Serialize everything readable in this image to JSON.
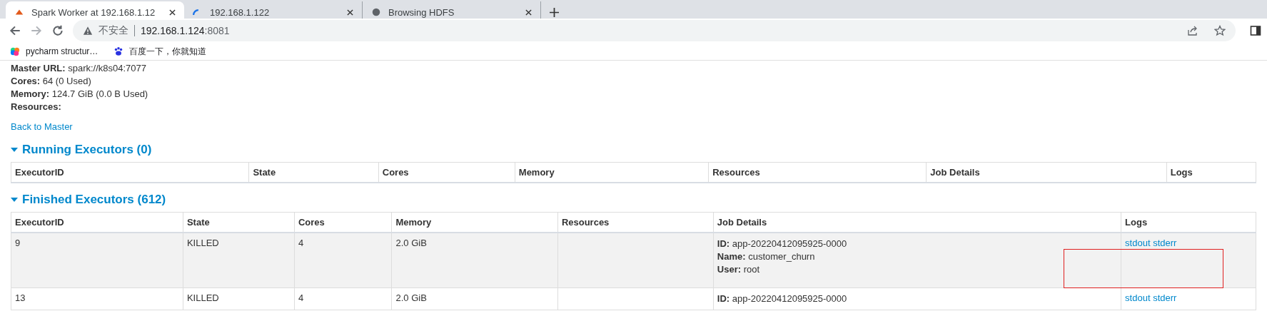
{
  "tabs": [
    {
      "title": "Spark Worker at 192.168.1.12",
      "kind": "spark",
      "selected": true
    },
    {
      "title": "192.168.1.122",
      "kind": "loading",
      "selected": false
    },
    {
      "title": "Browsing HDFS",
      "kind": "globe",
      "selected": false
    }
  ],
  "address": {
    "security": "不安全",
    "host": "192.168.1.124",
    "port": ":8081"
  },
  "bookmarks": [
    {
      "label": "pycharm structur…",
      "kind": "pycharm"
    },
    {
      "label": "百度一下，你就知道",
      "kind": "baidu"
    }
  ],
  "info": [
    {
      "label": "Master URL:",
      "value": "spark://k8s04:7077"
    },
    {
      "label": "Cores:",
      "value": "64 (0 Used)"
    },
    {
      "label": "Memory:",
      "value": "124.7 GiB (0.0 B Used)"
    },
    {
      "label": "Resources:"
    }
  ],
  "back_link": "Back to Master",
  "sections": [
    {
      "title": "Running Executors (0)",
      "expanded": true,
      "columns": [
        "ExecutorID",
        "State",
        "Cores",
        "Memory",
        "Resources",
        "Job Details",
        "Logs"
      ]
    },
    {
      "title": "Finished Executors (612)",
      "expanded": true,
      "columns": [
        "ExecutorID",
        "State",
        "Cores",
        "Memory",
        "Resources",
        "Job Details",
        "Logs"
      ],
      "rows": [
        {
          "executor_id": "9",
          "state": "KILLED",
          "cores": "4",
          "memory": "2.0 GiB",
          "job": [
            {
              "label": "ID:",
              "value": "app-20220412095925-0000"
            },
            {
              "label": "Name:",
              "value": "customer_churn"
            },
            {
              "label": "User:",
              "value": "root"
            }
          ],
          "logs": [
            "stdout",
            "stderr"
          ]
        },
        {
          "executor_id": "13",
          "state": "KILLED",
          "cores": "4",
          "memory": "2.0 GiB",
          "job": [
            {
              "label": "ID:",
              "value": "app-20220412095925-0000"
            }
          ],
          "logs": [
            "stdout",
            "stderr"
          ]
        }
      ]
    }
  ]
}
